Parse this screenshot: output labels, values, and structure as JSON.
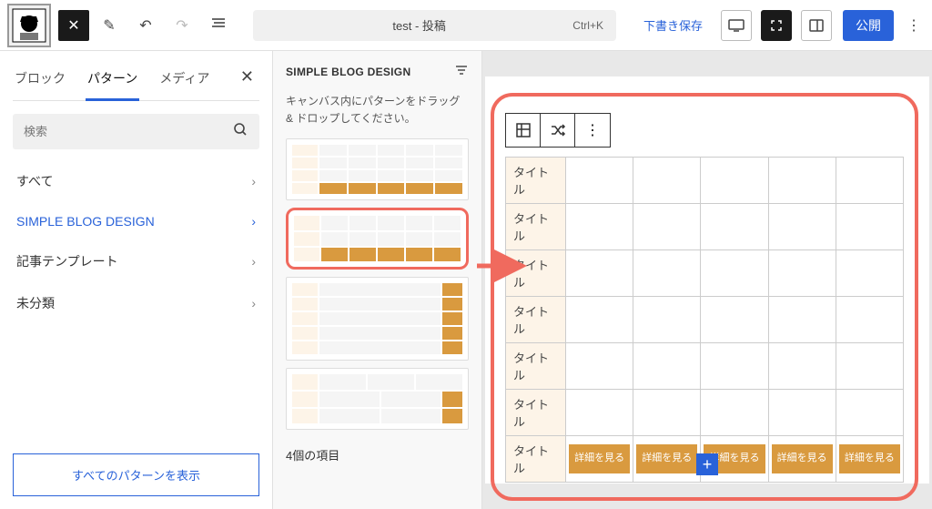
{
  "header": {
    "title": "test - 投稿",
    "shortcut": "Ctrl+K",
    "save_draft": "下書き保存",
    "publish": "公開"
  },
  "left_panel": {
    "tabs": [
      "ブロック",
      "パターン",
      "メディア"
    ],
    "active_tab": 1,
    "search_placeholder": "検索",
    "categories": [
      {
        "label": "すべて",
        "active": false
      },
      {
        "label": "SIMPLE BLOG DESIGN",
        "active": true
      },
      {
        "label": "記事テンプレート",
        "active": false
      },
      {
        "label": "未分類",
        "active": false
      }
    ],
    "show_all": "すべてのパターンを表示"
  },
  "mid_panel": {
    "title": "SIMPLE BLOG DESIGN",
    "hint": "キャンバス内にパターンをドラッグ & ドロップしてください。",
    "count": "4個の項目"
  },
  "canvas": {
    "row_title": "タイトル",
    "detail_button": "詳細を見る",
    "num_body_rows": 6,
    "num_cols": 5,
    "add_icon": "+"
  },
  "icons": {
    "close": "✕",
    "pencil": "✎",
    "undo": "↶",
    "redo": "↷",
    "list": "≣",
    "chevron_right": "›",
    "search": "⌕",
    "filter": "⚟",
    "table": "▦",
    "shuffle": "⤨",
    "dots": "⋮"
  }
}
